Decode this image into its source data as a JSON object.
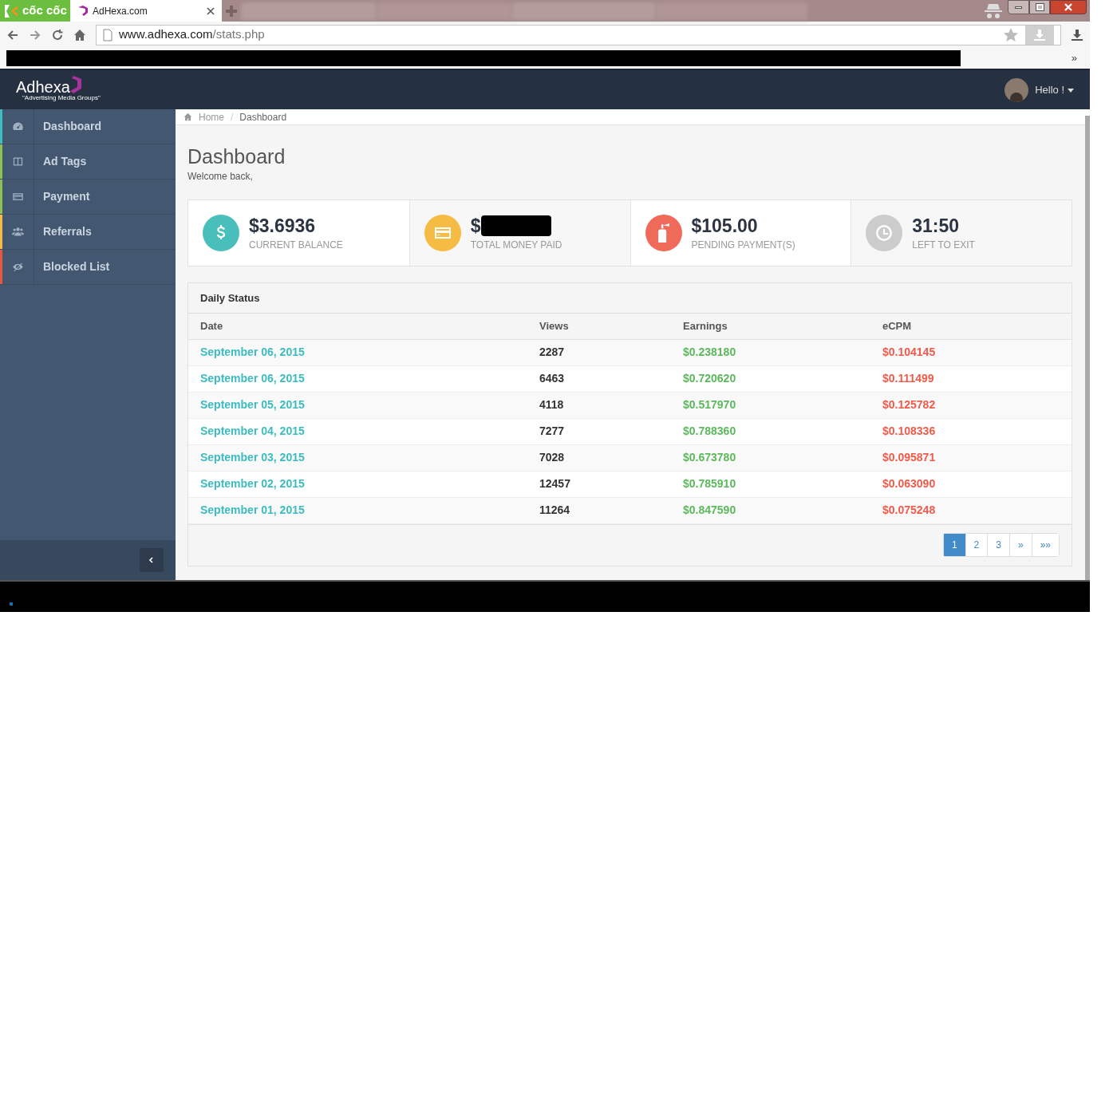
{
  "browser": {
    "brand": "cốc cốc",
    "tab_title": "AdHexa.com",
    "url_host": "www.adhexa.com",
    "url_path": "/stats.php",
    "bookmarks_more": "»"
  },
  "header": {
    "logo": "Adhexa",
    "logo_tagline": "\"Advertising Media Groups\"",
    "greeting": "Hello !"
  },
  "sidebar": {
    "items": [
      {
        "label": "Dashboard",
        "color": "#3dbfbf",
        "selected": false
      },
      {
        "label": "Ad Tags",
        "color": "#8cc152",
        "selected": false
      },
      {
        "label": "Payment",
        "color": "#8cc152",
        "selected": false
      },
      {
        "label": "Referrals",
        "color": "#f6bb42",
        "selected": false
      },
      {
        "label": "Blocked List",
        "color": "#e9573f",
        "selected": false
      }
    ]
  },
  "breadcrumb": [
    "Home",
    "/",
    "Dashboard"
  ],
  "page": {
    "title": "Dashboard",
    "subtitle": "Welcome back,"
  },
  "stats": [
    {
      "value": "$3.6936",
      "label": "CURRENT BALANCE",
      "color": "#48bfbb",
      "redacted": false
    },
    {
      "value": "$",
      "label": "TOTAL MONEY PAID",
      "color": "#f6bb42",
      "redacted": true
    },
    {
      "value": "$105.00",
      "label": "PENDING PAYMENT(S)",
      "color": "#f06a5a",
      "redacted": false
    },
    {
      "value": "31:50",
      "label": "LEFT TO EXIT",
      "color": "#cccccc",
      "redacted": false
    }
  ],
  "table": {
    "title": "Daily Status",
    "columns": [
      "Date",
      "Views",
      "Earnings",
      "eCPM"
    ],
    "rows": [
      [
        "September 06, 2015",
        "2287",
        "$0.238180",
        "$0.104145"
      ],
      [
        "September 06, 2015",
        "6463",
        "$0.720620",
        "$0.111499"
      ],
      [
        "September 05, 2015",
        "4118",
        "$0.517970",
        "$0.125782"
      ],
      [
        "September 04, 2015",
        "7277",
        "$0.788360",
        "$0.108336"
      ],
      [
        "September 03, 2015",
        "7028",
        "$0.673780",
        "$0.095871"
      ],
      [
        "September 02, 2015",
        "12457",
        "$0.785910",
        "$0.063090"
      ],
      [
        "September 01, 2015",
        "11264",
        "$0.847590",
        "$0.075248"
      ]
    ]
  },
  "pagination": [
    {
      "label": "1",
      "selected": true
    },
    {
      "label": "2",
      "selected": false
    },
    {
      "label": "3",
      "selected": false
    },
    {
      "label": "»",
      "selected": false
    },
    {
      "label": "»»",
      "selected": false
    }
  ]
}
